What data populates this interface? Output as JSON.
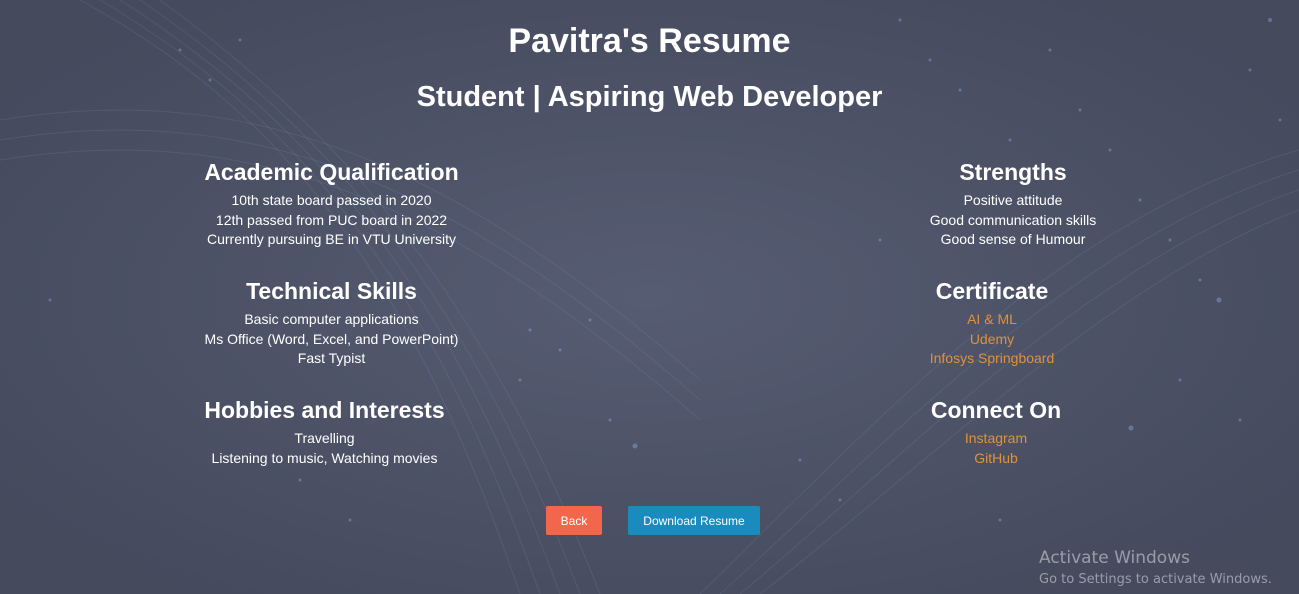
{
  "header": {
    "title": "Pavitra's Resume",
    "subtitle": "Student | Aspiring Web Developer"
  },
  "academic": {
    "heading": "Academic Qualification",
    "items": [
      "10th state board passed in 2020",
      "12th passed from PUC board in 2022",
      "Currently pursuing BE in VTU University"
    ]
  },
  "technical": {
    "heading": "Technical Skills",
    "items": [
      "Basic computer applications",
      "Ms Office (Word, Excel, and PowerPoint)",
      "Fast Typist"
    ]
  },
  "hobbies": {
    "heading": "Hobbies and Interests",
    "items": [
      "Travelling",
      "Listening to music, Watching movies"
    ]
  },
  "strengths": {
    "heading": "Strengths",
    "items": [
      "Positive attitude",
      "Good communication skills",
      "Good sense of Humour"
    ]
  },
  "certificate": {
    "heading": "Certificate",
    "links": [
      "AI & ML",
      "Udemy",
      "Infosys Springboard"
    ]
  },
  "connect": {
    "heading": "Connect On",
    "links": [
      "Instagram",
      "GitHub"
    ]
  },
  "buttons": {
    "back": "Back",
    "download": "Download Resume"
  },
  "watermark": {
    "title": "Activate Windows",
    "subtitle": "Go to Settings to activate Windows."
  },
  "colors": {
    "background": "#4b5064",
    "link": "#e0913a",
    "back_button": "#f2674b",
    "download_button": "#1a8bbd"
  }
}
